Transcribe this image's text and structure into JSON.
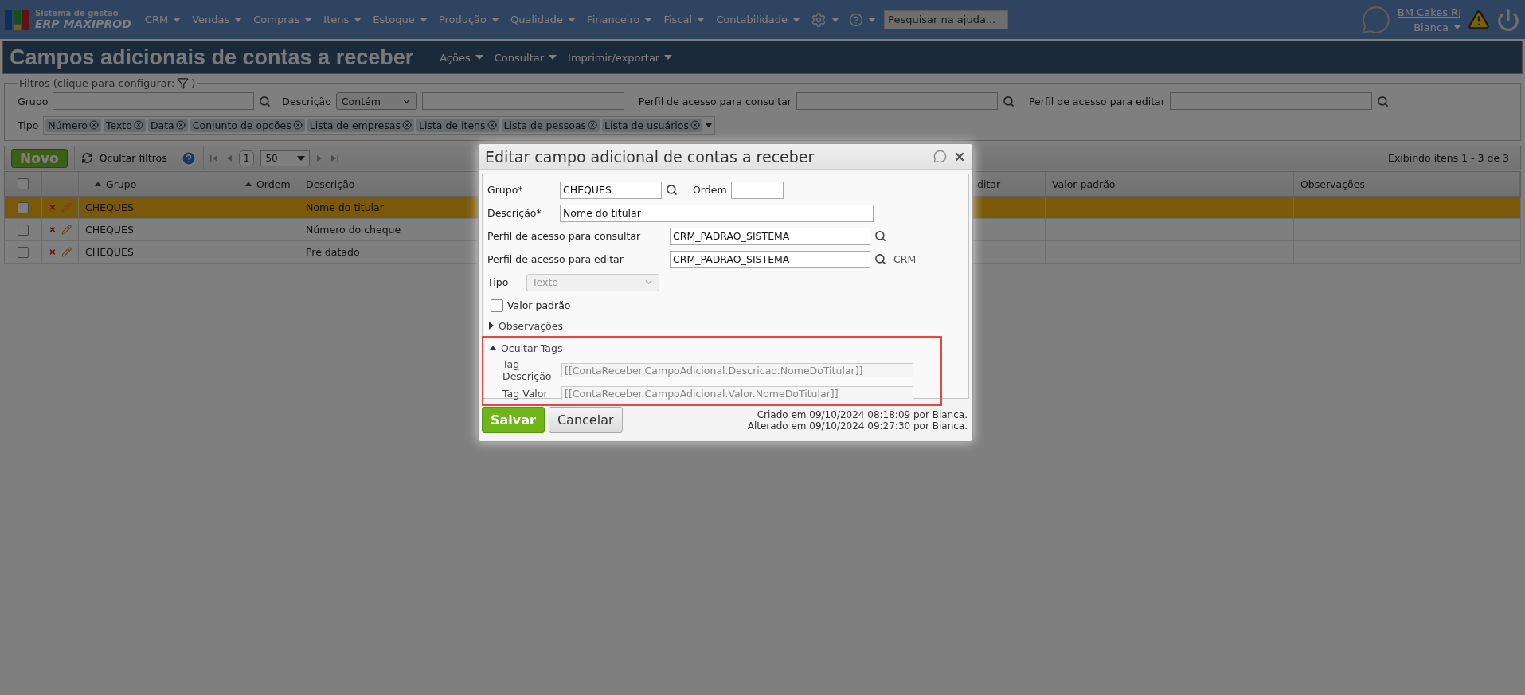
{
  "top_bar": {
    "logo": {
      "line_1": "Sistema de gestão",
      "line_2": "ERP MAXIPROD"
    },
    "menus": [
      "CRM",
      "Vendas",
      "Compras",
      "Itens",
      "Estoque",
      "Produção",
      "Qualidade",
      "Financeiro",
      "Fiscal",
      "Contabilidade"
    ],
    "help_search": {
      "placeholder": "Pesquisar na ajuda..."
    },
    "company": "BM Cakes RJ",
    "user": "Bianca"
  },
  "page": {
    "title": "Campos adicionais de contas a receber",
    "menus": [
      "Ações",
      "Consultar",
      "Imprimir/exportar"
    ]
  },
  "filters": {
    "legend": "Filtros (clique para configurar:",
    "legend_end": ")",
    "fields": [
      {
        "kind": "lookup",
        "label": "Grupo"
      },
      {
        "kind": "operator",
        "label": "Descrição",
        "operator": "Contém"
      },
      {
        "kind": "lookup",
        "label": "Perfil de acesso para consultar"
      },
      {
        "kind": "lookup",
        "label": "Perfil de acesso para editar"
      }
    ],
    "tipo": {
      "label": "Tipo",
      "tags": [
        "Número",
        "Texto",
        "Data",
        "Conjunto de opções",
        "Lista de empresas",
        "Lista de itens",
        "Lista de pessoas",
        "Lista de usuários"
      ]
    }
  },
  "toolbar": {
    "new_button": "Novo",
    "hide_filters": "Ocultar filtros",
    "page": "1",
    "page_size": "50",
    "summary": "Exibindo itens 1 - 3 de 3"
  },
  "table": {
    "all_checked": false,
    "columns": [
      {
        "label": "Grupo",
        "sorted": true
      },
      {
        "label": "Ordem",
        "sorted": true
      },
      {
        "label": "Descrição",
        "sorted": false
      },
      {
        "label": "ditar",
        "sorted": false
      },
      {
        "label": "Valor padrão",
        "sorted": false
      },
      {
        "label": "Observações",
        "sorted": false
      }
    ],
    "rows": [
      {
        "selected": true,
        "checked": false,
        "grupo": "CHEQUES",
        "descricao": "Nome do titular"
      },
      {
        "selected": false,
        "checked": false,
        "grupo": "CHEQUES",
        "descricao": "Número do cheque"
      },
      {
        "selected": false,
        "checked": false,
        "grupo": "CHEQUES",
        "descricao": "Pré datado"
      }
    ]
  },
  "dialog": {
    "title": "Editar campo adicional de contas a receber",
    "grupo": {
      "label": "Grupo*",
      "value": "CHEQUES"
    },
    "ordem": {
      "label": "Ordem"
    },
    "descricao": {
      "label": "Descrição*",
      "value": "Nome do titular"
    },
    "perfil_consultar": {
      "label": "Perfil de acesso para consultar",
      "value": "CRM_PADRAO_SISTEMA"
    },
    "perfil_editar": {
      "label": "Perfil de acesso para editar",
      "value": "CRM_PADRAO_SISTEMA",
      "module": "CRM"
    },
    "tipo": {
      "label": "Tipo",
      "value": "Texto",
      "disabled": true
    },
    "valor_padrao": {
      "label": "Valor padrão",
      "checked": false
    },
    "observacoes": {
      "label": "Observações",
      "expanded": false
    },
    "tags": {
      "label": "Ocultar Tags",
      "expanded": true,
      "highlighted": true,
      "fields": [
        {
          "label": "Tag Descrição",
          "value": "[[ContaReceber.CampoAdicional.Descricao.NomeDoTitular]]"
        },
        {
          "label": "Tag Valor",
          "value": "[[ContaReceber.CampoAdicional.Valor.NomeDoTitular]]"
        }
      ]
    },
    "save": "Salvar",
    "cancel": "Cancelar",
    "created": "Criado em 09/10/2024 08:18:09 por Bianca.",
    "altered": "Alterado em 09/10/2024 09:27:30 por Bianca."
  }
}
